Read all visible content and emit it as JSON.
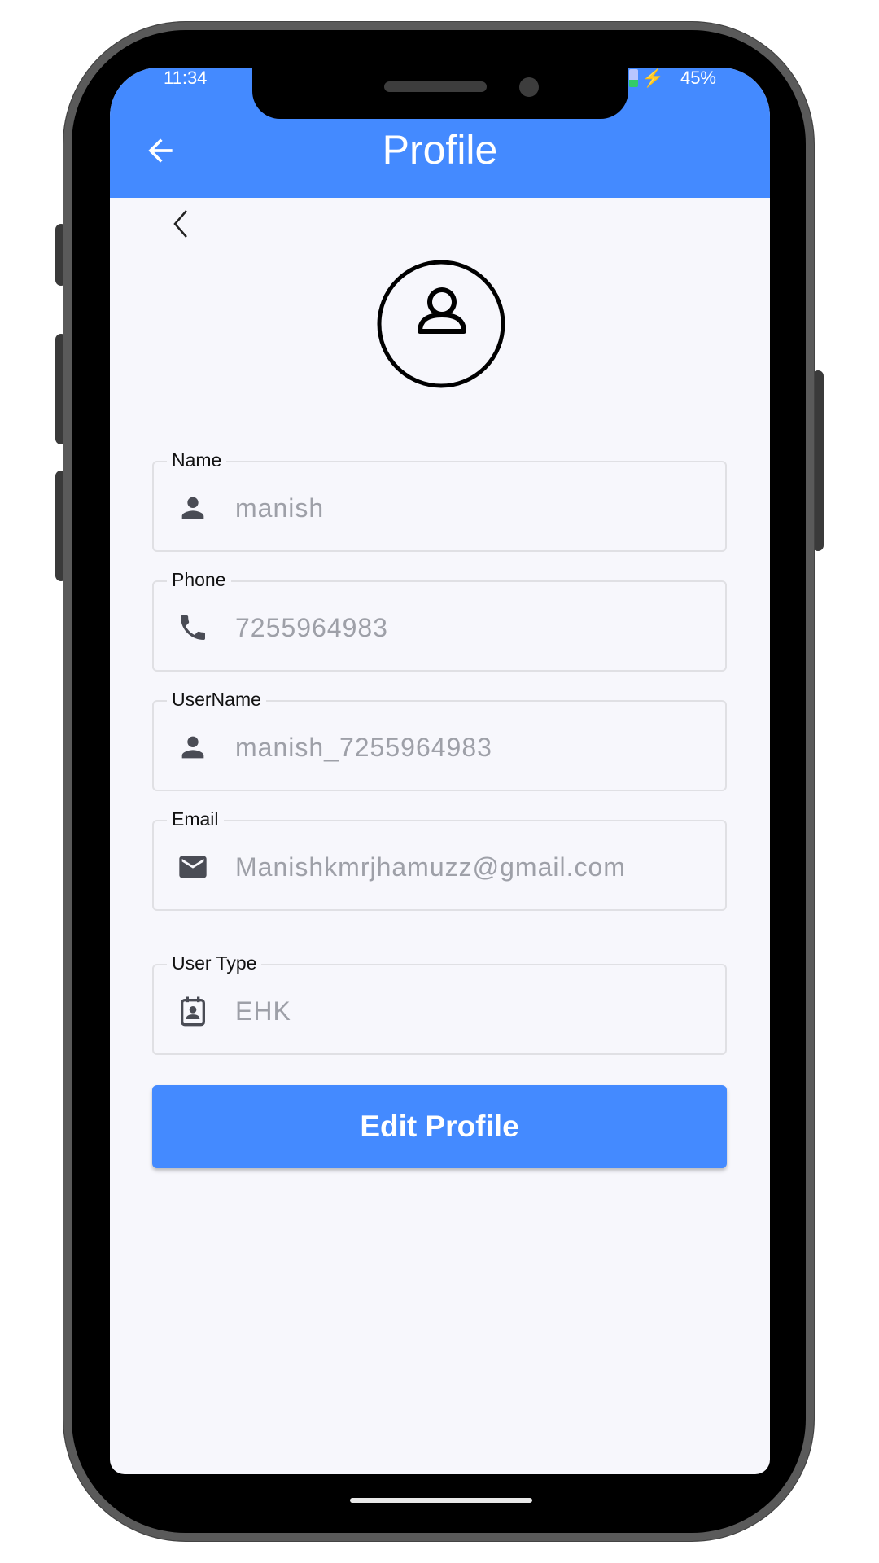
{
  "status_bar": {
    "time": "11:34",
    "battery": "45%"
  },
  "app_bar": {
    "title": "Profile",
    "back_icon": "arrow-left-icon",
    "color": "#448aff"
  },
  "avatar_icon": "person-circle-icon",
  "fields": {
    "name": {
      "label": "Name",
      "value": "manish",
      "icon": "person-icon"
    },
    "phone": {
      "label": "Phone",
      "value": "7255964983",
      "icon": "phone-icon"
    },
    "username": {
      "label": "UserName",
      "value": "manish_7255964983",
      "icon": "person-icon"
    },
    "email": {
      "label": "Email",
      "value": "Manishkmrjhamuzz@gmail.com",
      "icon": "mail-icon"
    },
    "user_type": {
      "label": "User Type",
      "value": "EHK",
      "icon": "contact-card-icon"
    }
  },
  "edit_button": {
    "label": "Edit Profile"
  }
}
